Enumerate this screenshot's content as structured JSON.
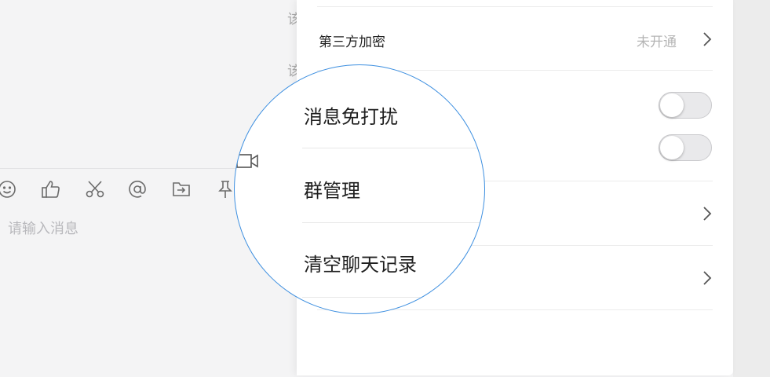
{
  "chat": {
    "input_placeholder": "请输入消息",
    "peek_text_1": "该",
    "peek_text_2": "该",
    "toolbar_icons": [
      "smile-icon",
      "thumbs-up-icon",
      "scissors-icon",
      "at-icon",
      "forward-icon",
      "pin-icon"
    ]
  },
  "settings": {
    "rows": [
      {
        "label": "第三方加密",
        "value": "未开通",
        "has_chevron": true
      },
      {
        "label": "",
        "toggle": false
      },
      {
        "label": "",
        "toggle": false
      },
      {
        "label": "",
        "has_chevron": true
      },
      {
        "label": "",
        "has_chevron": true
      }
    ]
  },
  "lens": {
    "items": [
      {
        "label": "消息免打扰"
      },
      {
        "label": "群管理"
      },
      {
        "label": "清空聊天记录"
      }
    ],
    "icon": "video-camera-icon"
  },
  "colors": {
    "lens_border": "#3d8fe0",
    "toggle_off": "#e9e9eb",
    "muted_text": "#b5b5b5"
  }
}
